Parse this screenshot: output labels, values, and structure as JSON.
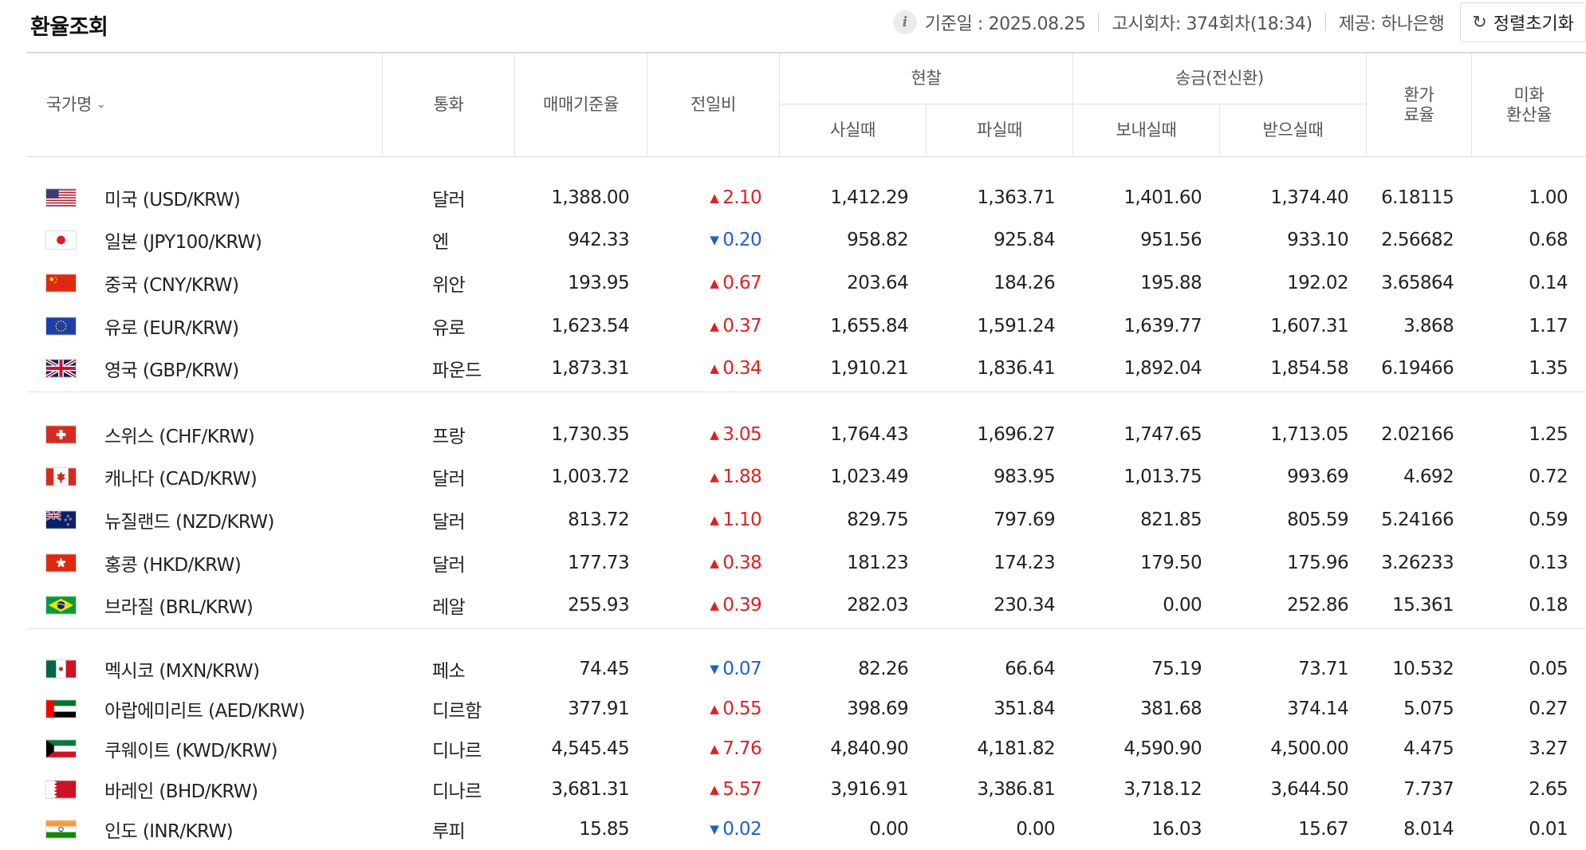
{
  "header": {
    "title": "환율조회",
    "base_date": "기준일 : 2025.08.25",
    "notice": "고시회차: 374회차(18:34)",
    "provider": "제공: 하나은행",
    "reset_label": "정렬초기화"
  },
  "columns": {
    "nation": "국가명",
    "currency": "통화",
    "base_rate": "매매기준율",
    "change": "전일비",
    "cash": "현찰",
    "cash_buy": "사실때",
    "cash_sell": "파실때",
    "transfer": "송금(전신환)",
    "send": "보내실때",
    "receive": "받으실때",
    "fee_l1": "환가",
    "fee_l2": "료율",
    "usd_l1": "미화",
    "usd_l2": "환산율"
  },
  "sections": [
    [
      {
        "name": "미국 (USD/KRW)",
        "currency": "달러",
        "base": "1,388.00",
        "dir": "up",
        "diff": "2.10",
        "cash_buy": "1,412.29",
        "cash_sell": "1,363.71",
        "send": "1,401.60",
        "receive": "1,374.40",
        "fee": "6.18115",
        "usd": "1.00",
        "flag": "us"
      },
      {
        "name": "일본 (JPY100/KRW)",
        "currency": "엔",
        "base": "942.33",
        "dir": "down",
        "diff": "0.20",
        "cash_buy": "958.82",
        "cash_sell": "925.84",
        "send": "951.56",
        "receive": "933.10",
        "fee": "2.56682",
        "usd": "0.68",
        "flag": "jp"
      },
      {
        "name": "중국 (CNY/KRW)",
        "currency": "위안",
        "base": "193.95",
        "dir": "up",
        "diff": "0.67",
        "cash_buy": "203.64",
        "cash_sell": "184.26",
        "send": "195.88",
        "receive": "192.02",
        "fee": "3.65864",
        "usd": "0.14",
        "flag": "cn"
      },
      {
        "name": "유로 (EUR/KRW)",
        "currency": "유로",
        "base": "1,623.54",
        "dir": "up",
        "diff": "0.37",
        "cash_buy": "1,655.84",
        "cash_sell": "1,591.24",
        "send": "1,639.77",
        "receive": "1,607.31",
        "fee": "3.868",
        "usd": "1.17",
        "flag": "eu"
      },
      {
        "name": "영국 (GBP/KRW)",
        "currency": "파운드",
        "base": "1,873.31",
        "dir": "up",
        "diff": "0.34",
        "cash_buy": "1,910.21",
        "cash_sell": "1,836.41",
        "send": "1,892.04",
        "receive": "1,854.58",
        "fee": "6.19466",
        "usd": "1.35",
        "flag": "gb"
      }
    ],
    [
      {
        "name": "스위스 (CHF/KRW)",
        "currency": "프랑",
        "base": "1,730.35",
        "dir": "up",
        "diff": "3.05",
        "cash_buy": "1,764.43",
        "cash_sell": "1,696.27",
        "send": "1,747.65",
        "receive": "1,713.05",
        "fee": "2.02166",
        "usd": "1.25",
        "flag": "ch"
      },
      {
        "name": "캐나다 (CAD/KRW)",
        "currency": "달러",
        "base": "1,003.72",
        "dir": "up",
        "diff": "1.88",
        "cash_buy": "1,023.49",
        "cash_sell": "983.95",
        "send": "1,013.75",
        "receive": "993.69",
        "fee": "4.692",
        "usd": "0.72",
        "flag": "ca"
      },
      {
        "name": "뉴질랜드 (NZD/KRW)",
        "currency": "달러",
        "base": "813.72",
        "dir": "up",
        "diff": "1.10",
        "cash_buy": "829.75",
        "cash_sell": "797.69",
        "send": "821.85",
        "receive": "805.59",
        "fee": "5.24166",
        "usd": "0.59",
        "flag": "nz"
      },
      {
        "name": "홍콩 (HKD/KRW)",
        "currency": "달러",
        "base": "177.73",
        "dir": "up",
        "diff": "0.38",
        "cash_buy": "181.23",
        "cash_sell": "174.23",
        "send": "179.50",
        "receive": "175.96",
        "fee": "3.26233",
        "usd": "0.13",
        "flag": "hk"
      },
      {
        "name": "브라질 (BRL/KRW)",
        "currency": "레알",
        "base": "255.93",
        "dir": "up",
        "diff": "0.39",
        "cash_buy": "282.03",
        "cash_sell": "230.34",
        "send": "0.00",
        "receive": "252.86",
        "fee": "15.361",
        "usd": "0.18",
        "flag": "br"
      }
    ],
    [
      {
        "name": "멕시코 (MXN/KRW)",
        "currency": "페소",
        "base": "74.45",
        "dir": "down",
        "diff": "0.07",
        "cash_buy": "82.26",
        "cash_sell": "66.64",
        "send": "75.19",
        "receive": "73.71",
        "fee": "10.532",
        "usd": "0.05",
        "flag": "mx"
      },
      {
        "name": "아랍에미리트 (AED/KRW)",
        "currency": "디르함",
        "base": "377.91",
        "dir": "up",
        "diff": "0.55",
        "cash_buy": "398.69",
        "cash_sell": "351.84",
        "send": "381.68",
        "receive": "374.14",
        "fee": "5.075",
        "usd": "0.27",
        "flag": "ae"
      },
      {
        "name": "쿠웨이트 (KWD/KRW)",
        "currency": "디나르",
        "base": "4,545.45",
        "dir": "up",
        "diff": "7.76",
        "cash_buy": "4,840.90",
        "cash_sell": "4,181.82",
        "send": "4,590.90",
        "receive": "4,500.00",
        "fee": "4.475",
        "usd": "3.27",
        "flag": "kw"
      },
      {
        "name": "바레인 (BHD/KRW)",
        "currency": "디나르",
        "base": "3,681.31",
        "dir": "up",
        "diff": "5.57",
        "cash_buy": "3,916.91",
        "cash_sell": "3,386.81",
        "send": "3,718.12",
        "receive": "3,644.50",
        "fee": "7.737",
        "usd": "2.65",
        "flag": "bh"
      },
      {
        "name": "인도 (INR/KRW)",
        "currency": "루피",
        "base": "15.85",
        "dir": "down",
        "diff": "0.02",
        "cash_buy": "0.00",
        "cash_sell": "0.00",
        "send": "16.03",
        "receive": "15.67",
        "fee": "8.014",
        "usd": "0.01",
        "flag": "in"
      }
    ]
  ],
  "colors": {
    "up": "#e02020",
    "down": "#1f5fd4"
  }
}
